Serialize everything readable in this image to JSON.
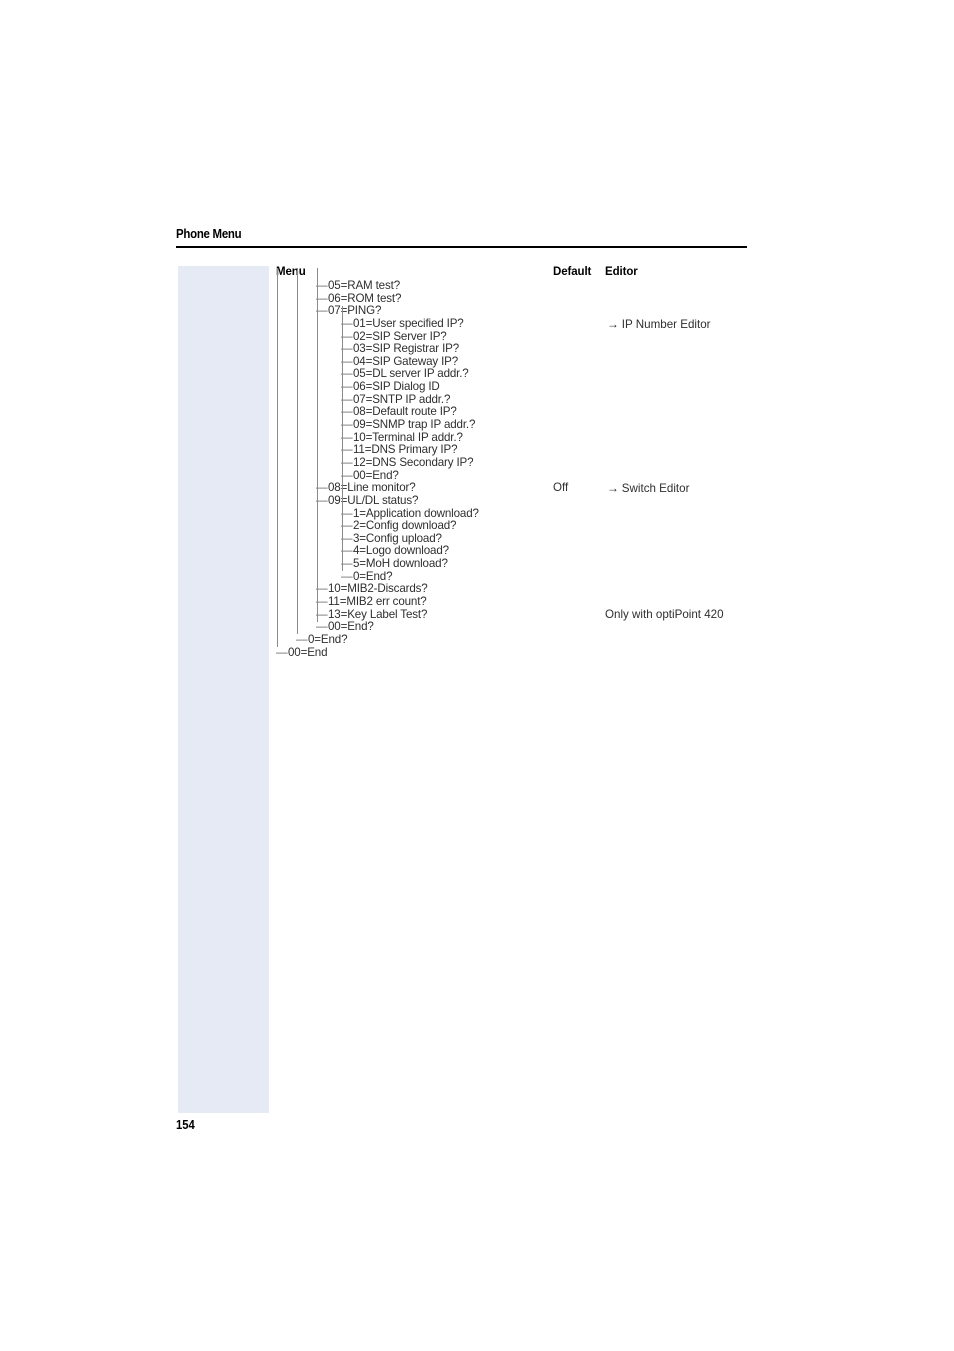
{
  "header": {
    "title": "Phone Menu"
  },
  "folio": {
    "page_number": "154"
  },
  "columns": {
    "menu": "Menu",
    "default": "Default",
    "editor": "Editor"
  },
  "icons": {
    "arrow": "→"
  },
  "colors": {
    "side_tab": "#e6eaf4",
    "rule": "#000000",
    "tree_line": "#8a8a8a",
    "text": "#2f2f2f"
  },
  "tree": {
    "rows": [
      {
        "level": 3,
        "branch": "—",
        "label": "05=RAM test?",
        "default": "",
        "editor": "",
        "note": ""
      },
      {
        "level": 3,
        "branch": "—",
        "label": "06=ROM test?",
        "default": "",
        "editor": "",
        "note": ""
      },
      {
        "level": 3,
        "branch": "—",
        "label": "07=PING?",
        "default": "",
        "editor": "",
        "note": ""
      },
      {
        "level": 4,
        "branch": "—",
        "label": "01=User specified IP?",
        "default": "",
        "editor": "IP Number Editor",
        "note": ""
      },
      {
        "level": 4,
        "branch": "—",
        "label": "02=SIP Server IP?",
        "default": "",
        "editor": "",
        "note": ""
      },
      {
        "level": 4,
        "branch": "—",
        "label": "03=SIP Registrar IP?",
        "default": "",
        "editor": "",
        "note": ""
      },
      {
        "level": 4,
        "branch": "—",
        "label": "04=SIP Gateway IP?",
        "default": "",
        "editor": "",
        "note": ""
      },
      {
        "level": 4,
        "branch": "—",
        "label": "05=DL server IP addr.?",
        "default": "",
        "editor": "",
        "note": ""
      },
      {
        "level": 4,
        "branch": "—",
        "label": "06=SIP Dialog ID",
        "default": "",
        "editor": "",
        "note": ""
      },
      {
        "level": 4,
        "branch": "—",
        "label": "07=SNTP IP addr.?",
        "default": "",
        "editor": "",
        "note": ""
      },
      {
        "level": 4,
        "branch": "—",
        "label": "08=Default route IP?",
        "default": "",
        "editor": "",
        "note": ""
      },
      {
        "level": 4,
        "branch": "—",
        "label": "09=SNMP trap IP addr.?",
        "default": "",
        "editor": "",
        "note": ""
      },
      {
        "level": 4,
        "branch": "—",
        "label": "10=Terminal IP addr.?",
        "default": "",
        "editor": "",
        "note": ""
      },
      {
        "level": 4,
        "branch": "—",
        "label": "11=DNS Primary IP?",
        "default": "",
        "editor": "",
        "note": ""
      },
      {
        "level": 4,
        "branch": "—",
        "label": "12=DNS Secondary IP?",
        "default": "",
        "editor": "",
        "note": ""
      },
      {
        "level": 4,
        "branch": "—",
        "label": "00=End?",
        "default": "",
        "editor": "",
        "note": ""
      },
      {
        "level": 3,
        "branch": "—",
        "label": "08=Line monitor?",
        "default": "Off",
        "editor": "Switch Editor",
        "note": ""
      },
      {
        "level": 3,
        "branch": "—",
        "label": "09=UL/DL status?",
        "default": "",
        "editor": "",
        "note": ""
      },
      {
        "level": 4,
        "branch": "—",
        "label": "1=Application download?",
        "default": "",
        "editor": "",
        "note": ""
      },
      {
        "level": 4,
        "branch": "—",
        "label": "2=Config download?",
        "default": "",
        "editor": "",
        "note": ""
      },
      {
        "level": 4,
        "branch": "—",
        "label": "3=Config upload?",
        "default": "",
        "editor": "",
        "note": ""
      },
      {
        "level": 4,
        "branch": "—",
        "label": "4=Logo download?",
        "default": "",
        "editor": "",
        "note": ""
      },
      {
        "level": 4,
        "branch": "—",
        "label": "5=MoH download?",
        "default": "",
        "editor": "",
        "note": ""
      },
      {
        "level": 4,
        "branch": "—",
        "label": "0=End?",
        "default": "",
        "editor": "",
        "note": ""
      },
      {
        "level": 3,
        "branch": "—",
        "label": "10=MIB2-Discards?",
        "default": "",
        "editor": "",
        "note": ""
      },
      {
        "level": 3,
        "branch": "—",
        "label": "11=MIB2 err count?",
        "default": "",
        "editor": "",
        "note": ""
      },
      {
        "level": 3,
        "branch": "—",
        "label": "13=Key Label Test?",
        "default": "",
        "editor": "",
        "note": "Only with optiPoint 420"
      },
      {
        "level": 3,
        "branch": "—",
        "label": "00=End?",
        "default": "",
        "editor": "",
        "note": ""
      },
      {
        "level": 2,
        "branch": "—",
        "label": "0=End?",
        "default": "",
        "editor": "",
        "note": ""
      },
      {
        "level": 1,
        "branch": "—",
        "label": "00=End",
        "default": "",
        "editor": "",
        "note": ""
      }
    ]
  }
}
